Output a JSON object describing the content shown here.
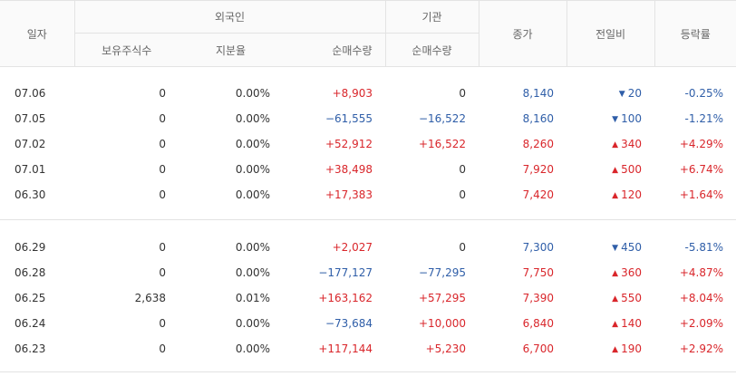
{
  "header": {
    "date": "일자",
    "foreign": "외국인",
    "institution": "기관",
    "holdings": "보유주식수",
    "share_ratio": "지분율",
    "foreign_net": "순매수량",
    "inst_net": "순매수량",
    "close": "종가",
    "change": "전일비",
    "rate": "등락률"
  },
  "colors": {
    "up": "#d9262b",
    "down": "#2f5ea8",
    "border": "#e3e3e3"
  },
  "group1": [
    {
      "date": "07.06",
      "holdings": "0",
      "ratio": "0.00%",
      "foreign_net": "+8,903",
      "foreign_dir": "up",
      "inst_net": "0",
      "inst_dir": "neu",
      "close": "8,140",
      "close_dir": "down",
      "arrow": "▼",
      "change": "20",
      "change_dir": "down",
      "rate": "-0.25%",
      "rate_dir": "down"
    },
    {
      "date": "07.05",
      "holdings": "0",
      "ratio": "0.00%",
      "foreign_net": "−61,555",
      "foreign_dir": "down",
      "inst_net": "−16,522",
      "inst_dir": "down",
      "close": "8,160",
      "close_dir": "down",
      "arrow": "▼",
      "change": "100",
      "change_dir": "down",
      "rate": "-1.21%",
      "rate_dir": "down"
    },
    {
      "date": "07.02",
      "holdings": "0",
      "ratio": "0.00%",
      "foreign_net": "+52,912",
      "foreign_dir": "up",
      "inst_net": "+16,522",
      "inst_dir": "up",
      "close": "8,260",
      "close_dir": "up",
      "arrow": "▲",
      "change": "340",
      "change_dir": "up",
      "rate": "+4.29%",
      "rate_dir": "up"
    },
    {
      "date": "07.01",
      "holdings": "0",
      "ratio": "0.00%",
      "foreign_net": "+38,498",
      "foreign_dir": "up",
      "inst_net": "0",
      "inst_dir": "neu",
      "close": "7,920",
      "close_dir": "up",
      "arrow": "▲",
      "change": "500",
      "change_dir": "up",
      "rate": "+6.74%",
      "rate_dir": "up"
    },
    {
      "date": "06.30",
      "holdings": "0",
      "ratio": "0.00%",
      "foreign_net": "+17,383",
      "foreign_dir": "up",
      "inst_net": "0",
      "inst_dir": "neu",
      "close": "7,420",
      "close_dir": "up",
      "arrow": "▲",
      "change": "120",
      "change_dir": "up",
      "rate": "+1.64%",
      "rate_dir": "up"
    }
  ],
  "group2": [
    {
      "date": "06.29",
      "holdings": "0",
      "ratio": "0.00%",
      "foreign_net": "+2,027",
      "foreign_dir": "up",
      "inst_net": "0",
      "inst_dir": "neu",
      "close": "7,300",
      "close_dir": "down",
      "arrow": "▼",
      "change": "450",
      "change_dir": "down",
      "rate": "-5.81%",
      "rate_dir": "down"
    },
    {
      "date": "06.28",
      "holdings": "0",
      "ratio": "0.00%",
      "foreign_net": "−177,127",
      "foreign_dir": "down",
      "inst_net": "−77,295",
      "inst_dir": "down",
      "close": "7,750",
      "close_dir": "up",
      "arrow": "▲",
      "change": "360",
      "change_dir": "up",
      "rate": "+4.87%",
      "rate_dir": "up"
    },
    {
      "date": "06.25",
      "holdings": "2,638",
      "ratio": "0.01%",
      "foreign_net": "+163,162",
      "foreign_dir": "up",
      "inst_net": "+57,295",
      "inst_dir": "up",
      "close": "7,390",
      "close_dir": "up",
      "arrow": "▲",
      "change": "550",
      "change_dir": "up",
      "rate": "+8.04%",
      "rate_dir": "up"
    },
    {
      "date": "06.24",
      "holdings": "0",
      "ratio": "0.00%",
      "foreign_net": "−73,684",
      "foreign_dir": "down",
      "inst_net": "+10,000",
      "inst_dir": "up",
      "close": "6,840",
      "close_dir": "up",
      "arrow": "▲",
      "change": "140",
      "change_dir": "up",
      "rate": "+2.09%",
      "rate_dir": "up"
    },
    {
      "date": "06.23",
      "holdings": "0",
      "ratio": "0.00%",
      "foreign_net": "+117,144",
      "foreign_dir": "up",
      "inst_net": "+5,230",
      "inst_dir": "up",
      "close": "6,700",
      "close_dir": "up",
      "arrow": "▲",
      "change": "190",
      "change_dir": "up",
      "rate": "+2.92%",
      "rate_dir": "up"
    }
  ]
}
